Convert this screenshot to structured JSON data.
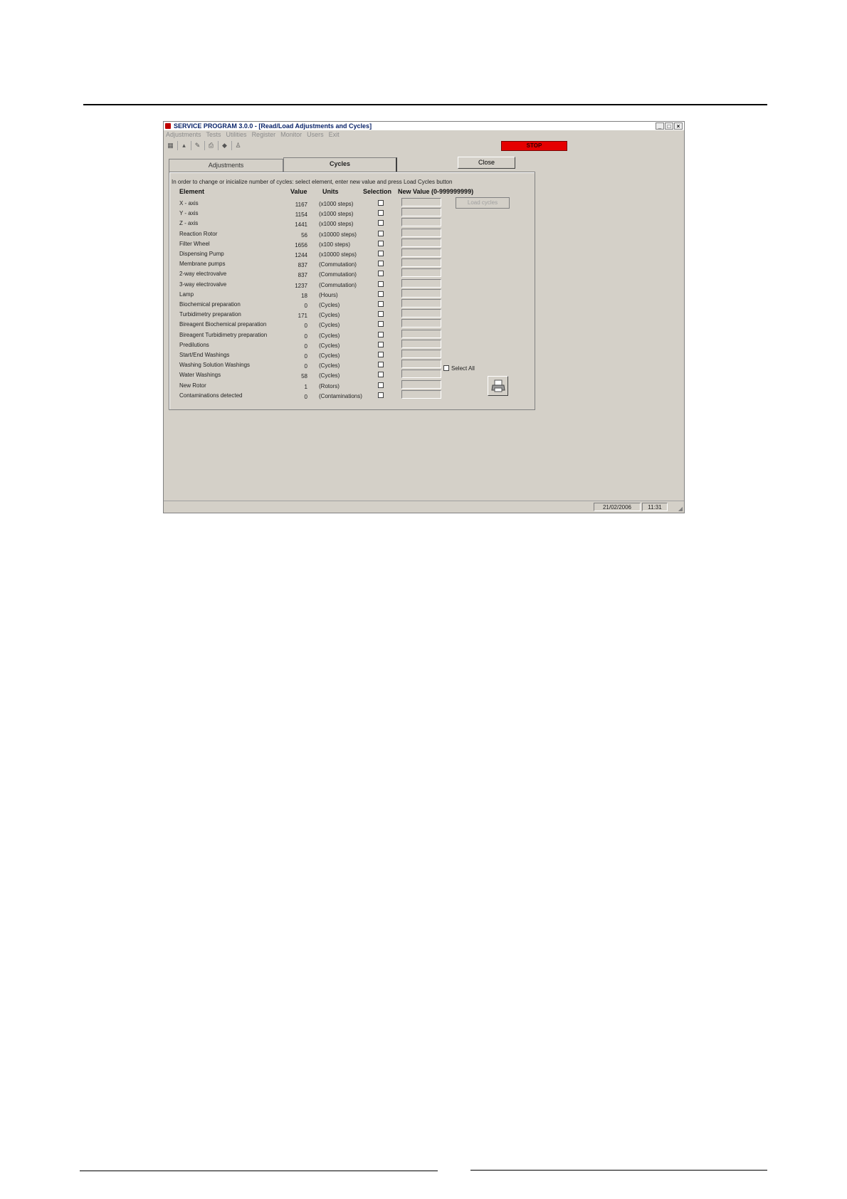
{
  "window": {
    "title": "SERVICE PROGRAM 3.0.0 - [Read/Load Adjustments and Cycles]",
    "controls": {
      "minimize": "_",
      "maximize": "□",
      "close": "×"
    }
  },
  "menu": [
    "Adjustments",
    "Tests",
    "Utilities",
    "Register",
    "Monitor",
    "Users",
    "Exit"
  ],
  "toolbar": {
    "stop_label": "STOP"
  },
  "tabs": {
    "adjustments": "Adjustments",
    "cycles": "Cycles"
  },
  "close_label": "Close",
  "instruction": "In order to change or inicialize number of cycles: select element, enter new value and press Load Cycles button",
  "headers": {
    "element": "Element",
    "value": "Value",
    "units": "Units",
    "selection": "Selection",
    "new_value": "New Value (0-999999999)"
  },
  "rows": [
    {
      "element": "X - axis",
      "value": "1167",
      "units": "(x1000 steps)"
    },
    {
      "element": "Y - axis",
      "value": "1154",
      "units": "(x1000 steps)"
    },
    {
      "element": "Z - axis",
      "value": "1441",
      "units": "(x1000 steps)"
    },
    {
      "element": "Reaction Rotor",
      "value": "56",
      "units": "(x10000 steps)"
    },
    {
      "element": "Filter Wheel",
      "value": "1656",
      "units": "(x100 steps)"
    },
    {
      "element": "Dispensing Pump",
      "value": "1244",
      "units": "(x10000 steps)"
    },
    {
      "element": "Membrane pumps",
      "value": "837",
      "units": "(Commutation)"
    },
    {
      "element": "2-way electrovalve",
      "value": "837",
      "units": "(Commutation)"
    },
    {
      "element": "3-way electrovalve",
      "value": "1237",
      "units": "(Commutation)"
    },
    {
      "element": "Lamp",
      "value": "18",
      "units": "(Hours)"
    },
    {
      "element": "Biochemical preparation",
      "value": "0",
      "units": "(Cycles)"
    },
    {
      "element": "Turbidimetry preparation",
      "value": "171",
      "units": "(Cycles)"
    },
    {
      "element": "Bireagent Biochemical preparation",
      "value": "0",
      "units": "(Cycles)"
    },
    {
      "element": "Bireagent Turbidimetry preparation",
      "value": "0",
      "units": "(Cycles)"
    },
    {
      "element": "Predilutions",
      "value": "0",
      "units": "(Cycles)"
    },
    {
      "element": "Start/End Washings",
      "value": "0",
      "units": "(Cycles)"
    },
    {
      "element": "Washing Solution Washings",
      "value": "0",
      "units": "(Cycles)"
    },
    {
      "element": "Water Washings",
      "value": "58",
      "units": "(Cycles)"
    },
    {
      "element": "New Rotor",
      "value": "1",
      "units": "(Rotors)"
    },
    {
      "element": "Contaminations detected",
      "value": "0",
      "units": "(Contaminations)"
    }
  ],
  "load_cycles_label": "Load cycles",
  "select_all_label": "Select All",
  "status": {
    "date": "21/02/2006",
    "time": "11:31"
  },
  "colors": {
    "stop": "#e50000",
    "window_bg": "#d4d0c8"
  }
}
